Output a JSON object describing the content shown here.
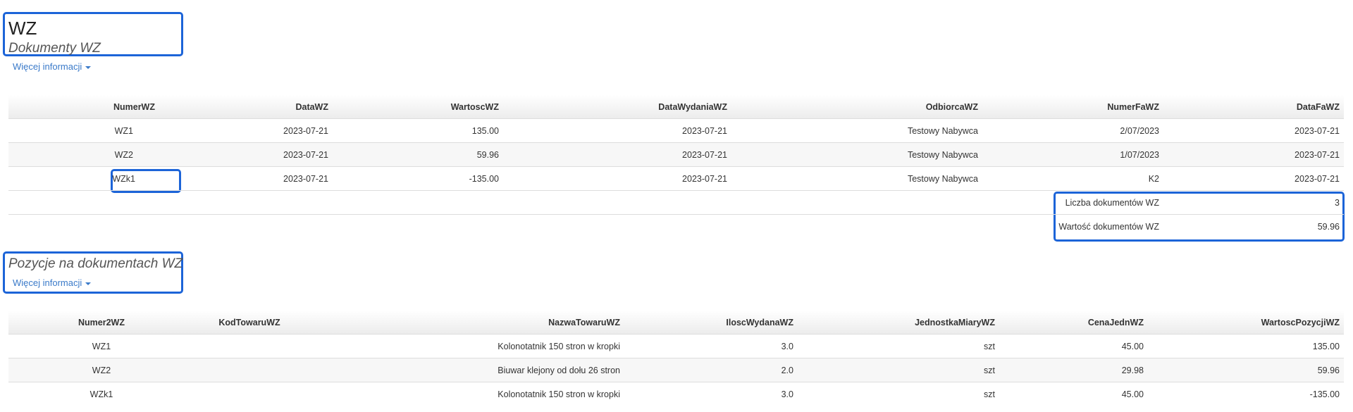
{
  "header": {
    "title": "WZ",
    "subtitle": "Dokumenty WZ",
    "more_info": "Więcej informacji"
  },
  "wz_table": {
    "columns": [
      "NumerWZ",
      "DataWZ",
      "WartoscWZ",
      "DataWydaniaWZ",
      "OdbiorcaWZ",
      "NumerFaWZ",
      "DataFaWZ"
    ],
    "rows": [
      [
        "WZ1",
        "2023-07-21",
        "135.00",
        "2023-07-21",
        "Testowy Nabywca",
        "2/07/2023",
        "2023-07-21"
      ],
      [
        "WZ2",
        "2023-07-21",
        "59.96",
        "2023-07-21",
        "Testowy Nabywca",
        "1/07/2023",
        "2023-07-21"
      ],
      [
        "WZk1",
        "2023-07-21",
        "-135.00",
        "2023-07-21",
        "Testowy Nabywca",
        "K2",
        "2023-07-21"
      ]
    ],
    "summary": [
      {
        "label": "Liczba dokumentów WZ",
        "value": "3"
      },
      {
        "label": "Wartość dokumentów WZ",
        "value": "59.96"
      }
    ]
  },
  "positions": {
    "title": "Pozycje na dokumentach WZ",
    "more_info": "Więcej informacji",
    "columns": [
      "Numer2WZ",
      "KodTowaruWZ",
      "NazwaTowaruWZ",
      "IloscWydanaWZ",
      "JednostkaMiaryWZ",
      "CenaJednWZ",
      "WartoscPozycjiWZ"
    ],
    "rows": [
      [
        "WZ1",
        "",
        "Kolonotatnik 150 stron w kropki",
        "3.0",
        "szt",
        "45.00",
        "135.00"
      ],
      [
        "WZ2",
        "",
        "Biuwar klejony od dołu 26 stron",
        "2.0",
        "szt",
        "29.98",
        "59.96"
      ],
      [
        "WZk1",
        "",
        "Kolonotatnik 150 stron w kropki",
        "3.0",
        "szt",
        "45.00",
        "-135.00"
      ]
    ]
  },
  "colors": {
    "highlight": "#1c64d8",
    "link": "#3a7ac9"
  }
}
